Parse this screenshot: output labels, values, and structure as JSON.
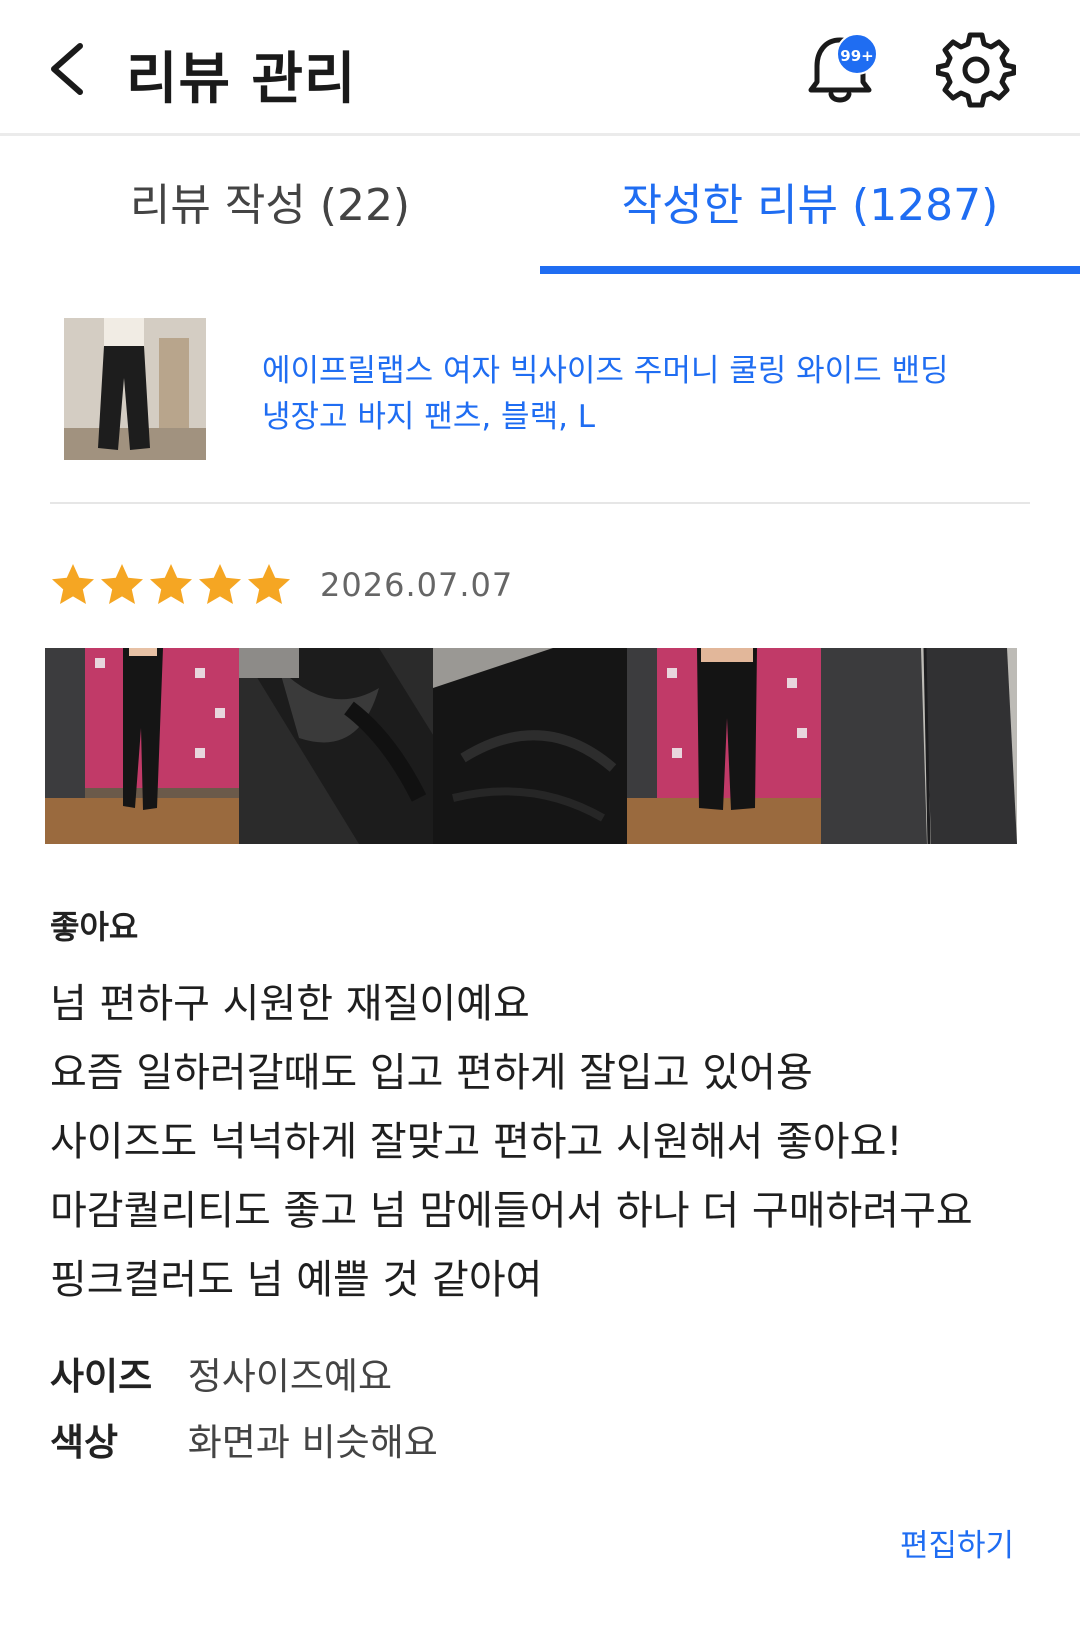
{
  "header": {
    "title": "리뷰 관리",
    "notification_badge": "99+",
    "back_icon": "chevron-left-icon",
    "bell_icon": "bell-icon",
    "settings_icon": "gear-icon"
  },
  "tabs": [
    {
      "label": "리뷰 작성 (22)",
      "active": false
    },
    {
      "label": "작성한 리뷰 (1287)",
      "active": true
    }
  ],
  "product": {
    "name_line1": "에이프릴랩스 여자 빅사이즈 주머니 쿨링 와이드 밴딩",
    "name_line2": "냉장고 바지 팬츠, 블랙, L"
  },
  "review": {
    "rating": 5,
    "max_rating": 5,
    "date": "2026.07.07",
    "photo_count": 5,
    "title": "좋아요",
    "body_lines": [
      "넘 편하구 시원한 재질이예요",
      "요즘 일하러갈때도 입고 편하게 잘입고 있어용",
      "사이즈도 넉넉하게 잘맞고 편하고 시원해서 좋아요!",
      "마감퀄리티도 좋고 넘 맘에들어서 하나 더 구매하려구요",
      "핑크컬러도 넘 예쁠 것 같아여"
    ],
    "attributes": [
      {
        "label": "사이즈",
        "value": "정사이즈예요"
      },
      {
        "label": "색상",
        "value": "화면과 비슷해요"
      }
    ],
    "edit_label": "편집하기"
  },
  "colors": {
    "accent": "#1f6df2",
    "star": "#f5a623"
  }
}
